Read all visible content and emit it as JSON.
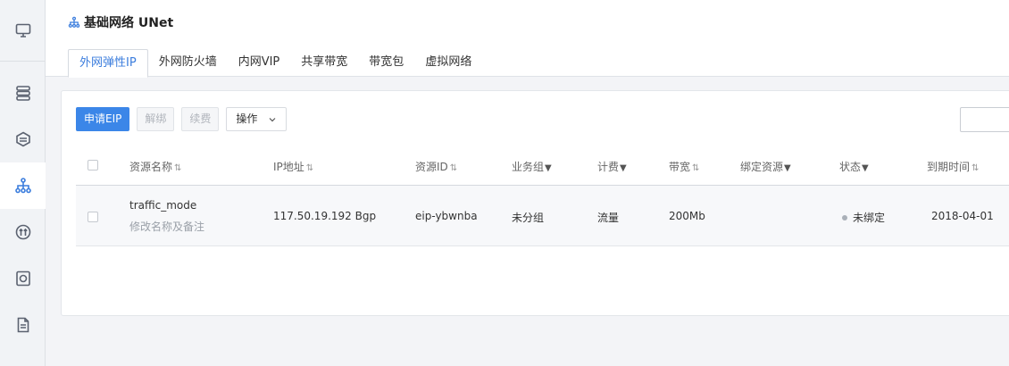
{
  "sidebar": {
    "items": [
      {
        "icon": "monitor-icon"
      },
      {
        "icon": "database-icon"
      },
      {
        "icon": "hexagon-icon"
      },
      {
        "icon": "network-icon"
      },
      {
        "icon": "bandwidth-icon"
      },
      {
        "icon": "disk-icon"
      },
      {
        "icon": "document-icon"
      }
    ],
    "active_index": 3
  },
  "header": {
    "title": "基础网络 UNet",
    "tabs": [
      {
        "label": "外网弹性IP",
        "active": true
      },
      {
        "label": "外网防火墙"
      },
      {
        "label": "内网VIP"
      },
      {
        "label": "共享带宽"
      },
      {
        "label": "带宽包"
      },
      {
        "label": "虚拟网络"
      }
    ]
  },
  "toolbar": {
    "apply_label": "申请EIP",
    "unbind_label": "解绑",
    "renew_label": "续费",
    "ops_label": "操作"
  },
  "table": {
    "columns": {
      "name": "资源名称",
      "ip": "IP地址",
      "id": "资源ID",
      "group": "业务组",
      "billing": "计费",
      "bandwidth": "带宽",
      "binding": "绑定资源",
      "status": "状态",
      "expire": "到期时间"
    },
    "sort_glyph": "⇅",
    "filter_glyph": "▼",
    "rows": [
      {
        "name": "traffic_mode",
        "name_hint": "修改名称及备注",
        "ip": "117.50.19.192 Bgp",
        "id": "eip-ybwnba",
        "group": "未分组",
        "billing": "流量",
        "bandwidth": "200Mb",
        "binding": "",
        "status": "未绑定",
        "expire": "2018-04-01"
      }
    ]
  },
  "colors": {
    "accent": "#3b7ddd",
    "primary_button": "#3b86e8",
    "status_unbound": "#aab0b8"
  }
}
